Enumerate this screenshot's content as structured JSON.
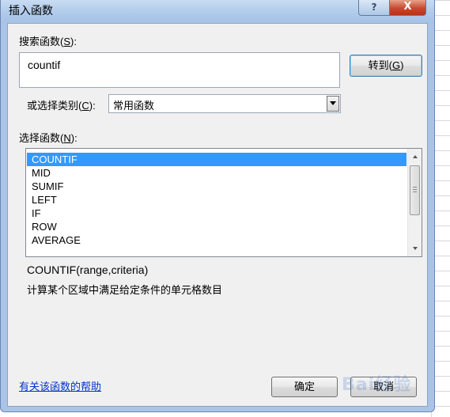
{
  "window": {
    "title": "插入函数",
    "help_glyph": "?",
    "close_glyph": "X"
  },
  "search": {
    "label_prefix": "搜索函数(",
    "label_key": "S",
    "label_suffix": "):",
    "value": "countif",
    "goto_prefix": "转到(",
    "goto_key": "G",
    "goto_suffix": ")"
  },
  "category": {
    "label_prefix": "或选择类别(",
    "label_key": "C",
    "label_suffix": "):",
    "selected": "常用函数"
  },
  "functions": {
    "label_prefix": "选择函数(",
    "label_key": "N",
    "label_suffix": "):",
    "items": [
      "COUNTIF",
      "MID",
      "SUMIF",
      "LEFT",
      "IF",
      "ROW",
      "AVERAGE"
    ],
    "selected_index": 0
  },
  "description": {
    "signature": "COUNTIF(range,criteria)",
    "text": "计算某个区域中满足给定条件的单元格数目"
  },
  "footer": {
    "help_link": "有关该函数的帮助",
    "ok_label": "确定",
    "cancel_label": "取消"
  },
  "watermark": "Bai经验",
  "colors": {
    "selection": "#3399ff",
    "link": "#0033cc",
    "title_bar": "#b1cbeb",
    "close_button": "#c64a2e"
  }
}
